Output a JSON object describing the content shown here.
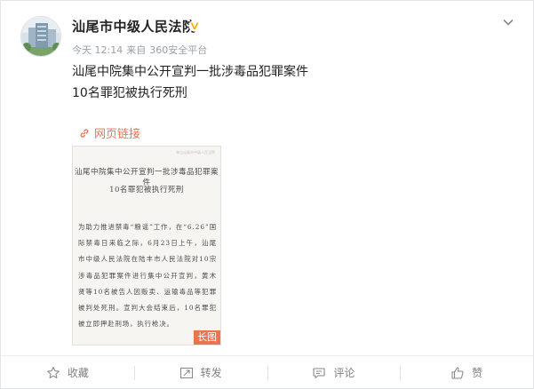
{
  "post": {
    "author": "汕尾市中级人民法院",
    "time": "今天 12:14",
    "source_prefix": "来自",
    "source": "360安全平台",
    "text_lines": [
      "汕尾中院集中公开宣判一批涉毒品犯罪案件",
      "10名罪犯被执行死刑"
    ],
    "web_link_label": "网页链接"
  },
  "long_image": {
    "source_note": "来自汕尾市中级人民法院",
    "title_line1": "汕尾中院集中公开宣判一批涉毒品犯罪案件",
    "title_line2": "10名罪犯被执行死刑",
    "paragraph": "为助力推进禁毒“粮谣”工作，在“6.26”国际禁毒日来临之际，6月23日上午，汕尾市中级人民法院在陆丰市人民法院对10宗涉毒品犯罪案件进行集中公开宣判，黄木贤等10名被告人因贩卖、运输毒品等犯罪被判处死刑。宣判大会结束后，10名罪犯被立即押赴刑场，执行枪决。",
    "badge": "长图"
  },
  "actions": {
    "favorite": "收藏",
    "repost": "转发",
    "comment": "评论",
    "like": "赞"
  },
  "colors": {
    "accent": "#eb7350",
    "verified": "#ffa900",
    "muted": "#808080"
  },
  "icons": {
    "more": "chevron-down-icon",
    "verified": "verified-v-icon",
    "link": "link-icon",
    "favorite": "star-icon",
    "repost": "share-icon",
    "comment": "comment-icon",
    "like": "thumbs-up-icon"
  }
}
